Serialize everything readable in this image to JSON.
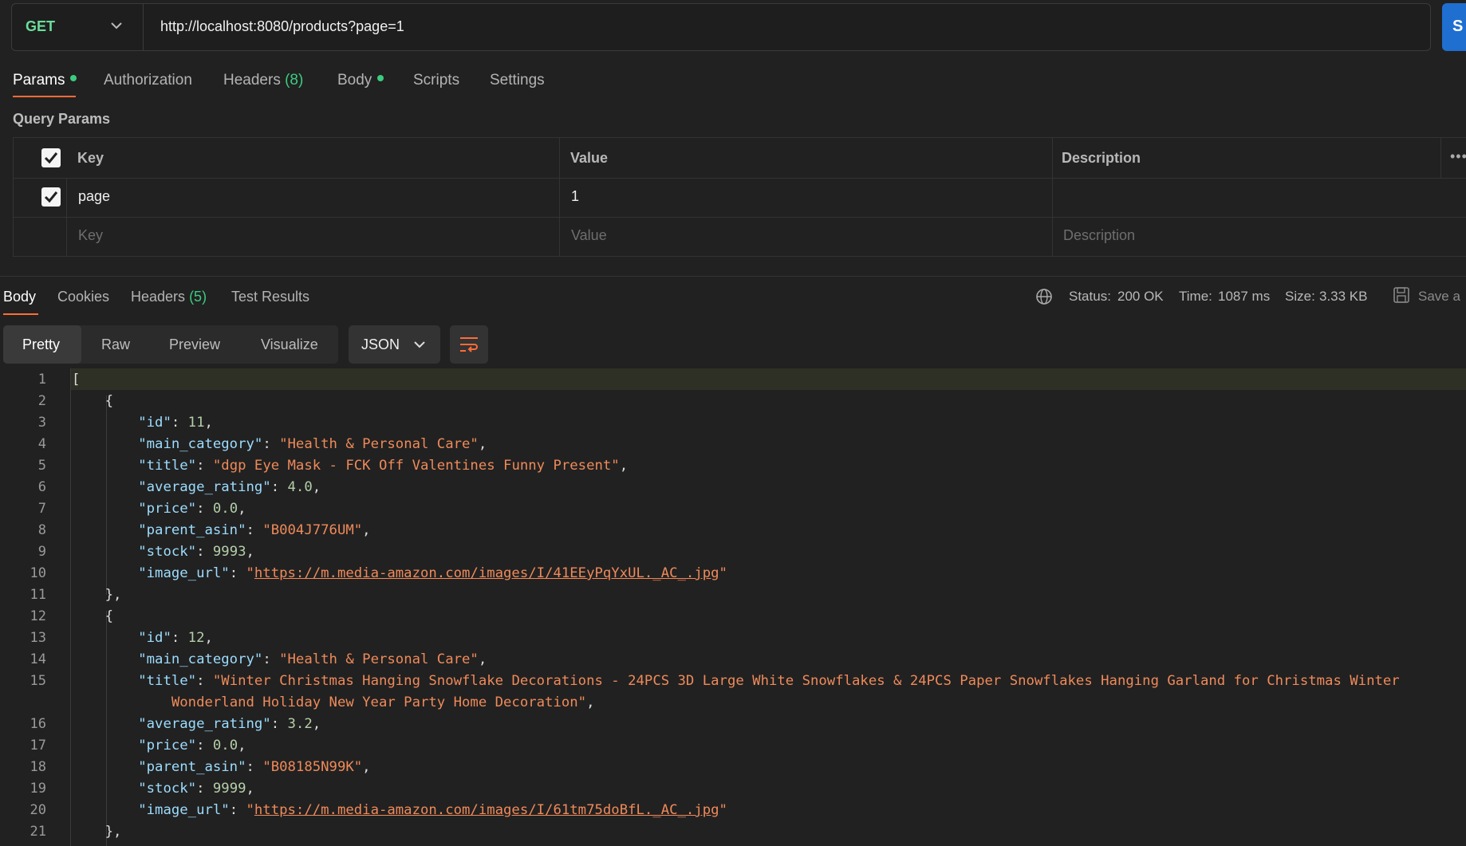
{
  "request": {
    "method": "GET",
    "url": "http://localhost:8080/products?page=1",
    "send_label": "S"
  },
  "request_tabs": {
    "params": "Params",
    "authorization": "Authorization",
    "headers": "Headers",
    "headers_count": "(8)",
    "body": "Body",
    "scripts": "Scripts",
    "settings": "Settings"
  },
  "query_params": {
    "title": "Query Params",
    "columns": {
      "key": "Key",
      "value": "Value",
      "description": "Description"
    },
    "rows": [
      {
        "key": "page",
        "value": "1",
        "description": "",
        "checked": true
      }
    ],
    "placeholder": {
      "key": "Key",
      "value": "Value",
      "description": "Description"
    }
  },
  "response_tabs": {
    "body": "Body",
    "cookies": "Cookies",
    "headers": "Headers",
    "headers_count": "(5)",
    "test_results": "Test Results"
  },
  "response_meta": {
    "status_label": "Status:",
    "status_value": "200 OK",
    "time_label": "Time:",
    "time_value": "1087 ms",
    "size_label": "Size:",
    "size_value": "3.33 KB",
    "save_label": "Save a"
  },
  "view": {
    "pretty": "Pretty",
    "raw": "Raw",
    "preview": "Preview",
    "visualize": "Visualize",
    "format": "JSON"
  },
  "colors": {
    "accent": "#ff6c37",
    "success": "#3ccb7f",
    "send": "#1f6fd1",
    "json_key": "#9cdcfe",
    "json_string": "#ef8a5a",
    "json_number": "#b5cea8"
  },
  "code": {
    "line_numbers": [
      "1",
      "2",
      "3",
      "4",
      "5",
      "6",
      "7",
      "8",
      "9",
      "10",
      "11",
      "12",
      "13",
      "14",
      "15",
      "",
      "16",
      "17",
      "18",
      "19",
      "20",
      "21"
    ],
    "products": [
      {
        "id": "11",
        "main_category": "\"Health & Personal Care\"",
        "title": "\"dgp Eye Mask - FCK Off Valentines Funny Present\"",
        "average_rating": "4.0",
        "price": "0.0",
        "parent_asin": "\"B004J776UM\"",
        "stock": "9993",
        "image_url": "https://m.media-amazon.com/images/I/41EEyPqYxUL._AC_.jpg"
      },
      {
        "id": "12",
        "main_category": "\"Health & Personal Care\"",
        "title_line1": "\"Winter Christmas Hanging Snowflake Decorations - 24PCS 3D Large White Snowflakes & 24PCS Paper Snowflakes Hanging Garland for Christmas Winter",
        "title_line2": "Wonderland Holiday New Year Party Home Decoration\"",
        "average_rating": "3.2",
        "price": "0.0",
        "parent_asin": "\"B08185N99K\"",
        "stock": "9999",
        "image_url": "https://m.media-amazon.com/images/I/61tm75doBfL._AC_.jpg"
      }
    ]
  }
}
